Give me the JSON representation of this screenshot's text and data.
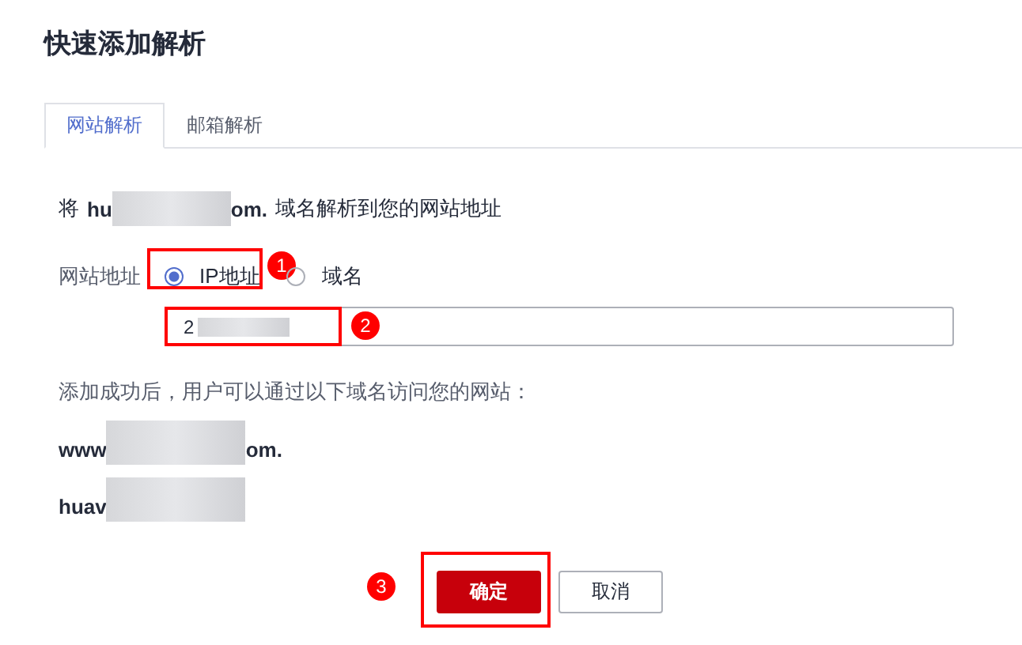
{
  "title": "快速添加解析",
  "tabs": [
    {
      "label": "网站解析",
      "selected": true
    },
    {
      "label": "邮箱解析",
      "selected": false
    }
  ],
  "intro": {
    "prefix": "将",
    "domain_start": "hu",
    "domain_end": "om.",
    "suffix": "域名解析到您的网站地址"
  },
  "address": {
    "label": "网站地址",
    "options": [
      {
        "label": "IP地址",
        "selected": true
      },
      {
        "label": "域名",
        "selected": false
      }
    ],
    "value": "2"
  },
  "result_text": "添加成功后，用户可以通过以下域名访问您的网站：",
  "domains": [
    {
      "start": "www",
      "end": "om."
    },
    {
      "start": "huav"
    }
  ],
  "buttons": [
    {
      "label": "确定",
      "kind": "primary"
    },
    {
      "label": "取消",
      "kind": "secondary"
    }
  ],
  "annotations": [
    {
      "number": "1"
    },
    {
      "number": "2"
    },
    {
      "number": "3"
    }
  ]
}
